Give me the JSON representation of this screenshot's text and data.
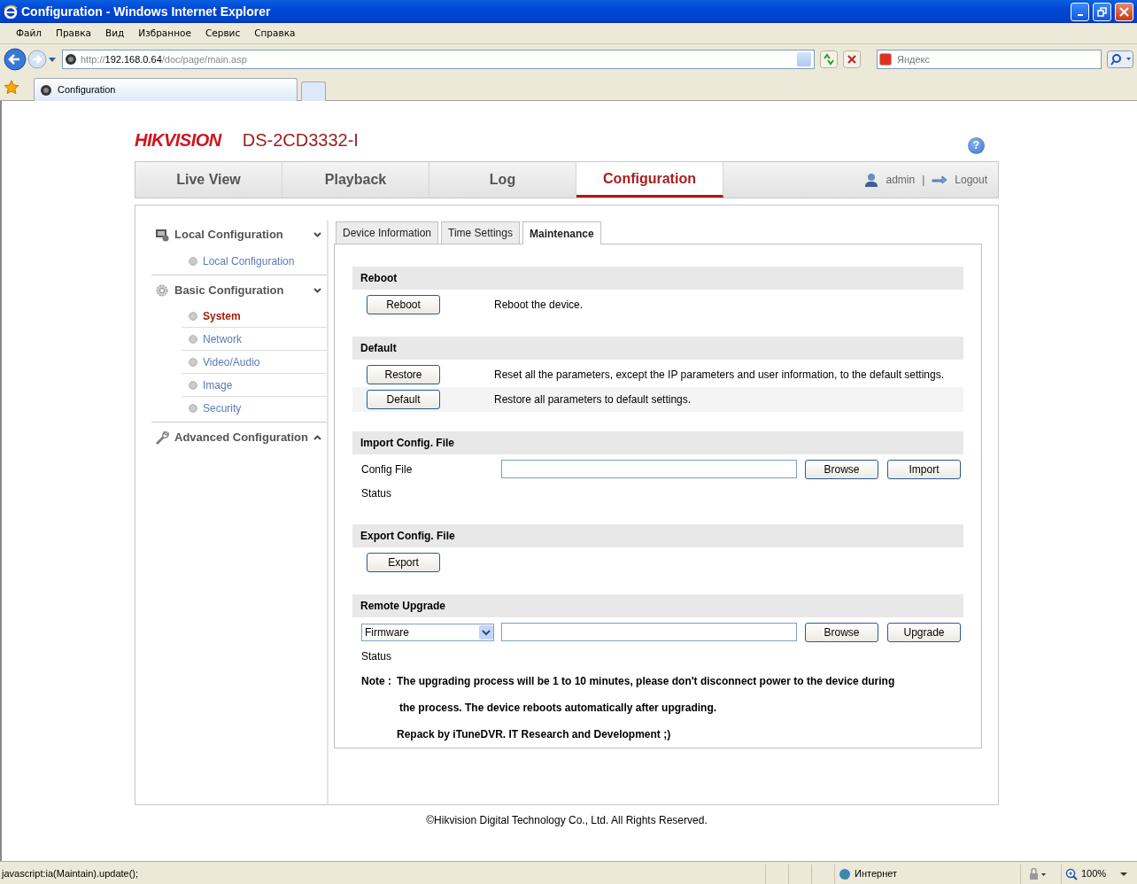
{
  "window": {
    "title": "Configuration - Windows Internet Explorer"
  },
  "menu": [
    "Файл",
    "Правка",
    "Вид",
    "Избранное",
    "Сервис",
    "Справка"
  ],
  "address": {
    "scheme": "http://",
    "host": "192.168.0.64",
    "path": "/doc/page/main.asp"
  },
  "search": {
    "placeholder": "Яндекс"
  },
  "browser_tabs": [
    {
      "label": "Configuration",
      "selected": true
    }
  ],
  "header": {
    "logo": "HIKVISION",
    "model": "DS-2CD3332-I",
    "help": "?"
  },
  "nav": [
    {
      "label": "Live View",
      "selected": false
    },
    {
      "label": "Playback",
      "selected": false
    },
    {
      "label": "Log",
      "selected": false
    },
    {
      "label": "Configuration",
      "selected": true
    }
  ],
  "user": {
    "name": "admin",
    "separator": "|",
    "logout": "Logout"
  },
  "sidebar": [
    {
      "label": "Local Configuration",
      "expanded": true,
      "children": [
        {
          "label": "Local Configuration",
          "selected": false
        }
      ]
    },
    {
      "label": "Basic Configuration",
      "expanded": true,
      "children": [
        {
          "label": "System",
          "selected": true
        },
        {
          "label": "Network",
          "selected": false
        },
        {
          "label": "Video/Audio",
          "selected": false
        },
        {
          "label": "Image",
          "selected": false
        },
        {
          "label": "Security",
          "selected": false
        }
      ]
    },
    {
      "label": "Advanced Configuration",
      "expanded": false
    }
  ],
  "tabs": [
    {
      "label": "Device Information",
      "selected": false
    },
    {
      "label": "Time Settings",
      "selected": false
    },
    {
      "label": "Maintenance",
      "selected": true
    }
  ],
  "sections": [
    {
      "title": "Reboot",
      "rows": [
        {
          "kind": "action",
          "button": "Reboot",
          "description": "Reboot the device.",
          "highlighted": false
        }
      ]
    },
    {
      "title": "Default",
      "rows": [
        {
          "kind": "action",
          "button": "Restore",
          "description": "Reset all the parameters, except the IP parameters and user information, to the default settings.",
          "highlighted": false
        },
        {
          "kind": "action",
          "button": "Default",
          "description": "Restore all parameters to default settings.",
          "highlighted": true
        }
      ]
    },
    {
      "title": "Import Config. File",
      "rows": [
        {
          "kind": "file",
          "label": "Config File",
          "buttons": [
            "Browse",
            "Import"
          ]
        },
        {
          "kind": "status",
          "label": "Status"
        }
      ]
    },
    {
      "title": "Export Config. File",
      "rows": [
        {
          "kind": "action",
          "button": "Export",
          "highlighted": false
        }
      ]
    },
    {
      "title": "Remote Upgrade",
      "rows": [
        {
          "kind": "file",
          "select": "Firmware",
          "buttons": [
            "Browse",
            "Upgrade"
          ]
        },
        {
          "kind": "status",
          "label": "Status"
        },
        {
          "kind": "note",
          "label": "Note :",
          "lines": [
            "The upgrading process will be 1 to 10 minutes, please don't disconnect power to the device during",
            "the process. The device reboots automatically after upgrading.",
            "Repack by iTuneDVR. IT Research and Development ;)"
          ]
        }
      ]
    }
  ],
  "footer": "©Hikvision Digital Technology Co., Ltd. All Rights Reserved.",
  "status_bar": {
    "text": "javascript:ia(Maintain).update();",
    "zone": "Интернет",
    "zoom": "100%"
  }
}
